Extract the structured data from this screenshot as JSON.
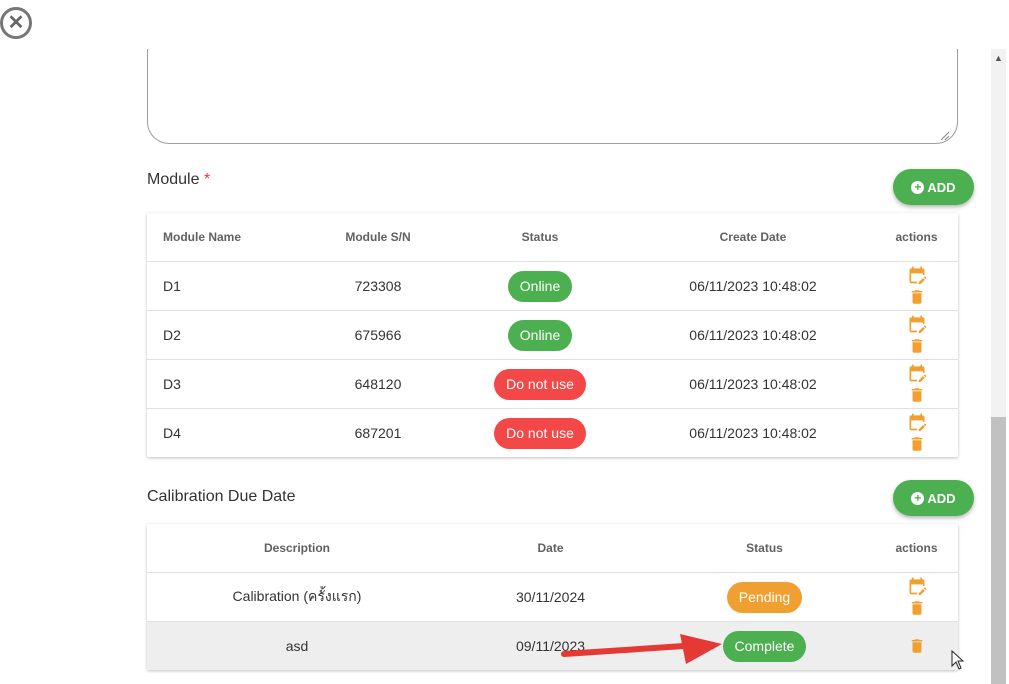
{
  "dialog": {
    "close_icon": "close-circle-icon",
    "close_glyph": "✕"
  },
  "module_section": {
    "title": "Module",
    "required_mark": "*",
    "add_label": "ADD",
    "add_icon": "plus-circle-icon",
    "columns": [
      "Module Name",
      "Module S/N",
      "Status",
      "Create Date",
      "actions"
    ],
    "rows": [
      {
        "name": "D1",
        "sn": "723308",
        "status": "Online",
        "status_color": "#4caf50",
        "created": "06/11/2023 10:48:02"
      },
      {
        "name": "D2",
        "sn": "675966",
        "status": "Online",
        "status_color": "#4caf50",
        "created": "06/11/2023 10:48:02"
      },
      {
        "name": "D3",
        "sn": "648120",
        "status": "Do not use",
        "status_color": "#f44747",
        "created": "06/11/2023 10:48:02"
      },
      {
        "name": "D4",
        "sn": "687201",
        "status": "Do not use",
        "status_color": "#f44747",
        "created": "06/11/2023 10:48:02"
      }
    ]
  },
  "calibration_section": {
    "title": "Calibration Due Date",
    "add_label": "ADD",
    "add_icon": "plus-circle-icon",
    "columns": [
      "Description",
      "Date",
      "Status",
      "actions"
    ],
    "rows": [
      {
        "description": "Calibration (ครั้งแรก)",
        "date": "30/11/2024",
        "status": "Pending",
        "status_color": "#f0a030"
      },
      {
        "description": "asd",
        "date": "09/11/2023",
        "status": "Complete",
        "status_color": "#4caf50"
      }
    ]
  },
  "colors": {
    "accent": "#4caf50",
    "danger": "#f44747",
    "warning": "#f0a030",
    "action_icon": "#f0a030",
    "annotation_arrow": "#e53935"
  }
}
